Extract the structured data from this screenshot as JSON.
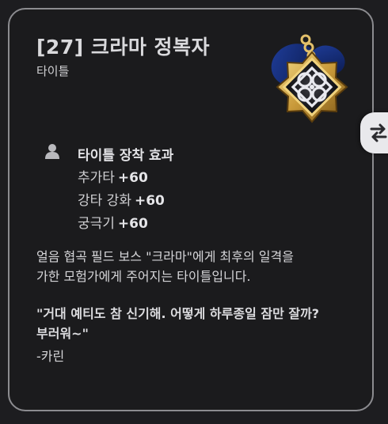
{
  "tooltip": {
    "title": "[27] 크라마 정복자",
    "category": "타이틀",
    "medal_icon": "medal-icon",
    "swap_icon": "swap-arrows-icon",
    "effect": {
      "icon": "person-icon",
      "header": "타이틀 장착 효과",
      "stats": [
        {
          "label": "추가타",
          "value": "+60"
        },
        {
          "label": "강타 강화",
          "value": "+60"
        },
        {
          "label": "궁극기",
          "value": "+60"
        }
      ]
    },
    "description": [
      "얼음 협곡 필드 보스 \"크라마\"에게 최후의 일격을",
      "가한 모험가에게 주어지는 타이틀입니다."
    ],
    "quote": [
      "\"거대 예티도 참 신기해. 어떻게 하루종일 잠만 잘까?",
      "부러워~\""
    ],
    "signature": "-카린"
  }
}
